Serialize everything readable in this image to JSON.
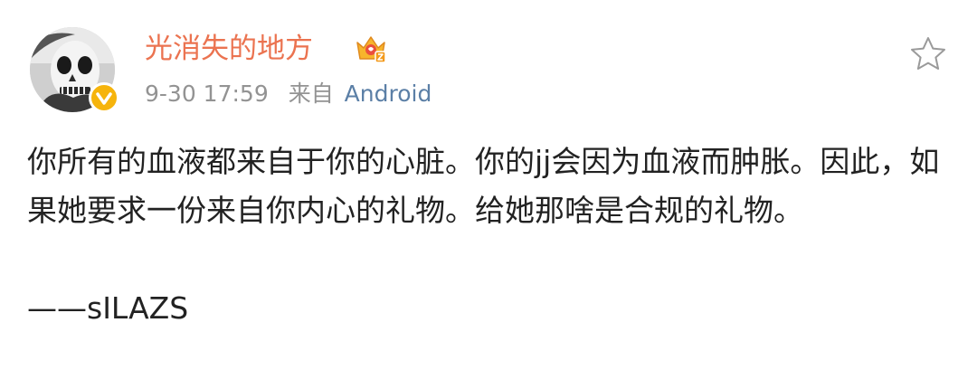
{
  "post": {
    "user_name": "光消失的地方",
    "time": "9-30 17:59",
    "from_label": "来自",
    "source": "Android",
    "text": "你所有的血液都来自于你的心脏。你的jj会因为血液而肿胀。因此，如果她要求一份来自你内心的礼物。给她那啥是合规的礼物。",
    "signature": "——sILAZS"
  },
  "icons": {
    "avatar": "avatar-image",
    "verified": "verified-badge-icon",
    "vip": "crown-icon",
    "favorite": "star-outline-icon"
  },
  "colors": {
    "name": "#eb7350",
    "meta": "#939393",
    "source_link": "#5b7fa6",
    "text": "#222222",
    "badge": "#f6b40c"
  }
}
